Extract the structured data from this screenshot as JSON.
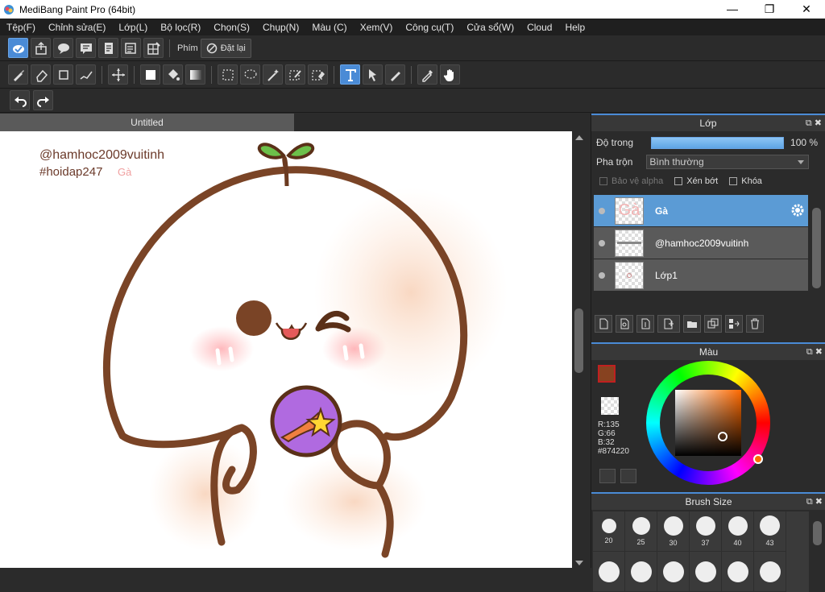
{
  "window": {
    "title": "MediBang Paint Pro (64bit)",
    "minimize": "—",
    "maximize": "❐",
    "close": "✕"
  },
  "menu": [
    "Tệp(F)",
    "Chỉnh sửa(E)",
    "Lớp(L)",
    "Bộ lọc(R)",
    "Chọn(S)",
    "Chụp(N)",
    "Màu (C)",
    "Xem(V)",
    "Công cụ(T)",
    "Cửa sổ(W)",
    "Cloud",
    "Help"
  ],
  "toolbar1": {
    "shortcut_label": "Phím",
    "reset_label": "Đặt lại"
  },
  "document": {
    "tab_title": "Untitled",
    "canvas_text": {
      "line1": "@hamhoc2009vuitinh",
      "line2": "#hoidap247",
      "line3": "Gà"
    }
  },
  "layer_panel": {
    "title": "Lớp",
    "opacity_label": "Độ trong",
    "opacity_value": "100 %",
    "blend_label": "Pha trộn",
    "blend_value": "Bình thường",
    "protect_alpha": "Bảo vệ alpha",
    "clipping": "Xén bớt",
    "lock": "Khóa",
    "layers": [
      {
        "name": "Gà",
        "selected": true
      },
      {
        "name": "@hamhoc2009vuitinh",
        "selected": false
      },
      {
        "name": "Lớp1",
        "selected": false
      }
    ]
  },
  "color_panel": {
    "title": "Màu",
    "r": "R:135",
    "g": "G:66",
    "b": "B:32",
    "hex": "#874220",
    "foreground": "#874220",
    "background": "#fff3d6"
  },
  "brush_panel": {
    "title": "Brush Size",
    "sizes": [
      "20",
      "25",
      "30",
      "37",
      "40",
      "43"
    ]
  }
}
